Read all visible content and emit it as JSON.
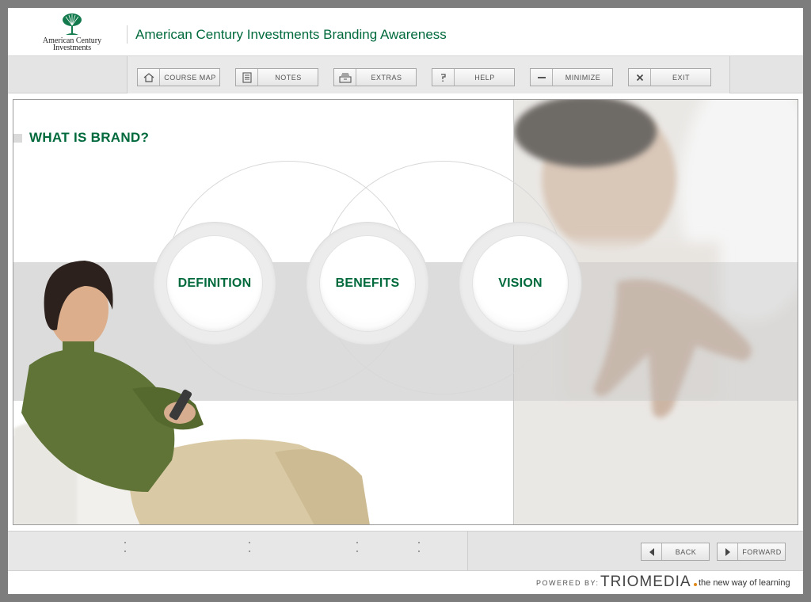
{
  "header": {
    "logo_text_line1": "American Century",
    "logo_text_line2": "Investments",
    "course_title": "American Century Investments Branding Awareness"
  },
  "toolbar": {
    "buttons": [
      {
        "label": "COURSE MAP",
        "icon": "home-icon"
      },
      {
        "label": "NOTES",
        "icon": "document-icon"
      },
      {
        "label": "EXTRAS",
        "icon": "file-box-icon"
      },
      {
        "label": "HELP",
        "icon": "question-icon"
      },
      {
        "label": "MINIMIZE",
        "icon": "minus-icon"
      },
      {
        "label": "EXIT",
        "icon": "close-icon"
      }
    ]
  },
  "content": {
    "heading": "WHAT IS BRAND?",
    "topics": [
      {
        "label": "DEFINITION"
      },
      {
        "label": "BENEFITS"
      },
      {
        "label": "VISION"
      }
    ]
  },
  "nav": {
    "back_label": "BACK",
    "forward_label": "FORWARD"
  },
  "footer": {
    "powered_by": "POWERED BY:",
    "brand": "TRIOMEDIA",
    "tagline": "the new way of learning"
  },
  "colors": {
    "accent_green": "#006a3c",
    "brand_dot": "#e08a1a"
  }
}
